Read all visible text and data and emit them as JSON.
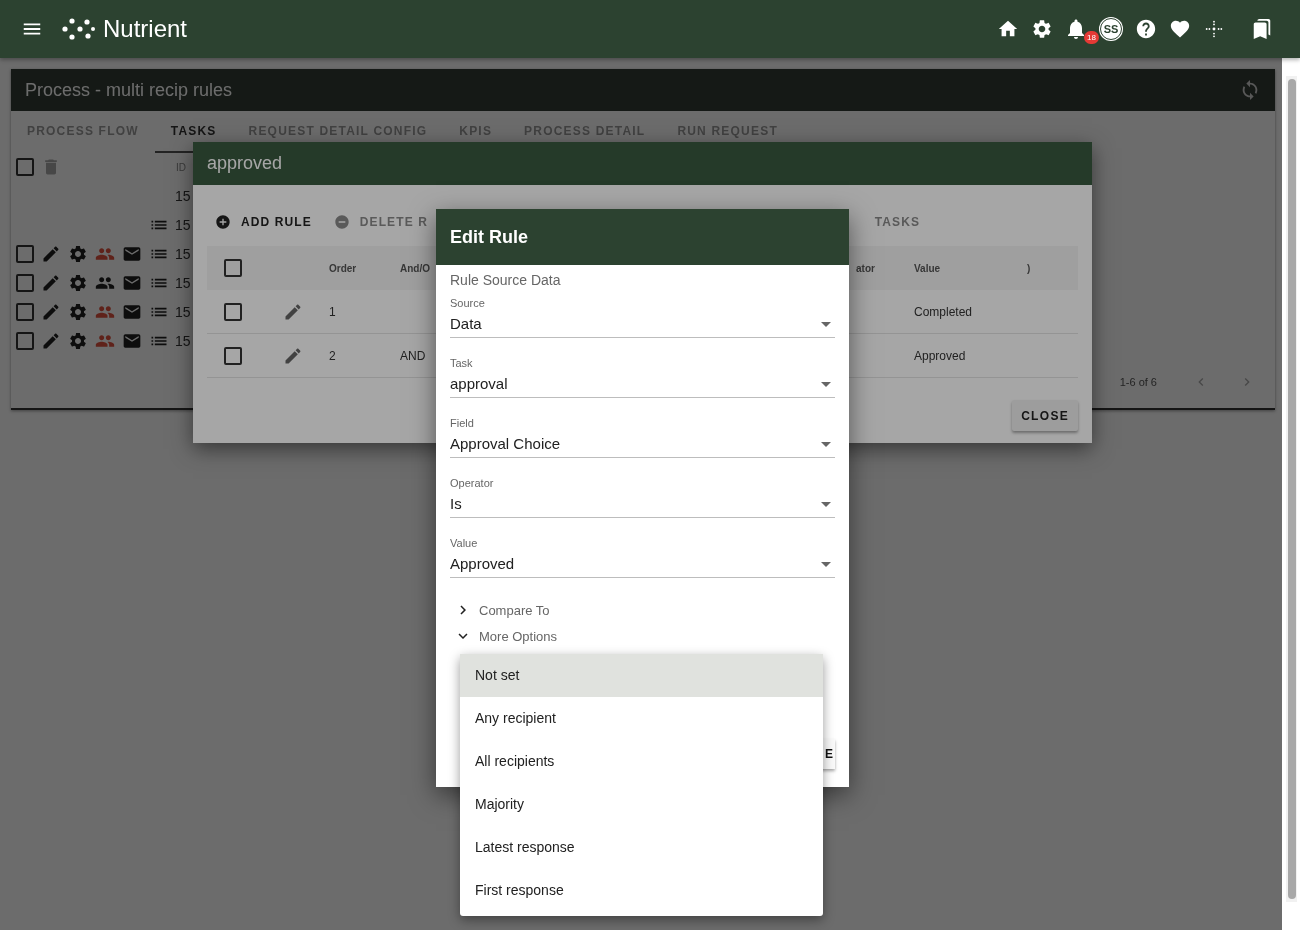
{
  "app_bar": {
    "title": "Nutrient",
    "notification_count": "18",
    "avatar_initials": "SS"
  },
  "page": {
    "title": "Process - multi recip rules",
    "tabs": [
      {
        "label": "PROCESS FLOW",
        "selected": false
      },
      {
        "label": "TASKS",
        "selected": true
      },
      {
        "label": "REQUEST DETAIL CONFIG",
        "selected": false
      },
      {
        "label": "KPIS",
        "selected": false
      },
      {
        "label": "PROCESS DETAIL",
        "selected": false
      },
      {
        "label": "RUN REQUEST",
        "selected": false
      }
    ],
    "table": {
      "id_column": "ID",
      "select_all_checked": false,
      "rows": [
        {
          "kind": "id_only",
          "id": "15"
        },
        {
          "kind": "list",
          "id": "15"
        },
        {
          "kind": "full",
          "id": "15",
          "checked": false,
          "alert": true
        },
        {
          "kind": "full",
          "id": "15",
          "checked": false,
          "alert": false
        },
        {
          "kind": "full",
          "id": "15",
          "checked": false,
          "alert": true
        },
        {
          "kind": "full",
          "id": "15",
          "checked": false,
          "alert": true
        }
      ]
    },
    "pagination": {
      "range": "1-6 of 6"
    }
  },
  "rules_dialog": {
    "title": "approved",
    "actions": [
      {
        "kind": "add",
        "label": "ADD RULE",
        "disabled": false
      },
      {
        "kind": "delete",
        "label": "DELETE R",
        "disabled": true
      },
      {
        "kind": "tasks",
        "label": "TASKS",
        "disabled": true
      }
    ],
    "columns": [
      "Order",
      "And/O",
      "ator",
      "Value",
      ")"
    ],
    "select_all_checked": false,
    "rows": [
      {
        "order": "1",
        "value": "Completed",
        "checked": false
      },
      {
        "order": "2",
        "and_or": "AND",
        "value": "Approved",
        "checked": false
      }
    ],
    "close_button": "CLOSE"
  },
  "edit_rule_dialog": {
    "title": "Edit Rule",
    "section_title": "Rule Source Data",
    "fields": [
      {
        "label": "Source",
        "value": "Data"
      },
      {
        "label": "Task",
        "value": "approval"
      },
      {
        "label": "Field",
        "value": "Approval Choice"
      },
      {
        "label": "Operator",
        "value": "Is"
      },
      {
        "label": "Value",
        "value": "Approved"
      }
    ],
    "sections": [
      {
        "label": "Compare To",
        "expanded": false
      },
      {
        "label": "More Options",
        "expanded": true
      }
    ],
    "button_fragment": "E"
  },
  "dropdown": {
    "options": [
      {
        "label": "Not set",
        "selected": true
      },
      {
        "label": "Any recipient",
        "selected": false
      },
      {
        "label": "All recipients",
        "selected": false
      },
      {
        "label": "Majority",
        "selected": false
      },
      {
        "label": "Latest response",
        "selected": false
      },
      {
        "label": "First response",
        "selected": false
      }
    ]
  }
}
